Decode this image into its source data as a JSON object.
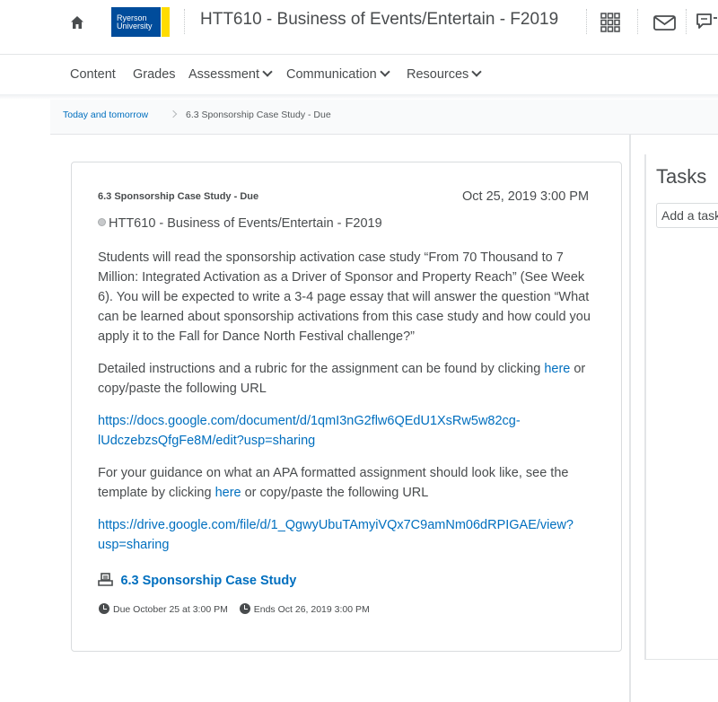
{
  "header": {
    "logo_text_line1": "Ryerson",
    "logo_text_line2": "University",
    "course_title": "HTT610 - Business of Events/Entertain - F2019",
    "icons": [
      "home-icon",
      "apps-grid-icon",
      "mail-icon",
      "chat-icon"
    ]
  },
  "nav": {
    "items": [
      {
        "label": "Content",
        "has_menu": false
      },
      {
        "label": "Grades",
        "has_menu": false
      },
      {
        "label": "Assessment",
        "has_menu": true
      },
      {
        "label": "Communication",
        "has_menu": true
      },
      {
        "label": "Resources",
        "has_menu": true
      }
    ]
  },
  "breadcrumb": {
    "link": "Today and tomorrow",
    "current": "6.3 Sponsorship Case Study - Due"
  },
  "event": {
    "title": "6.3 Sponsorship Case Study - Due",
    "date": "Oct 25, 2019 3:00 PM",
    "course": "HTT610 - Business of Events/Entertain - F2019",
    "paragraph1": "Students will read the sponsorship activation case study “From 70 Thousand to 7 Million: Integrated Activation as a Driver of Sponsor and Property Reach” (See Week 6).  You will be expected to write a 3-4 page essay that will answer the question “What can be learned about sponsorship activations from this case study and how could you apply it to the Fall for Dance North Festival challenge?”",
    "paragraph2_before": "Detailed instructions and a rubric for the assignment can be found by clicking ",
    "paragraph2_link": "here",
    "paragraph2_after": " or copy/paste the following URL",
    "url1_line1": "https://docs.google.com/document/d/1qmI3nG2flw6QEdU1XsRw5w82cg-",
    "url1_line2": "lUdczebzsQfgFe8M/edit?usp=sharing",
    "paragraph3_before": "For your guidance on what an APA formatted assignment should look like, see the template by clicking ",
    "paragraph3_link": "here",
    "paragraph3_after": " or copy/paste the following URL",
    "url2_line1": "https://drive.google.com/file/d/1_QgwyUbuTAmyiVQx7C9amNm06dRPIGAE/view?",
    "url2_line2": "usp=sharing",
    "attachment_label": "6.3 Sponsorship Case Study",
    "due_text": "Due October 25 at 3:00 PM",
    "ends_text": "Ends Oct 26, 2019 3:00 PM"
  },
  "tasks": {
    "title": "Tasks",
    "input_placeholder": "Add a task"
  },
  "colors": {
    "link": "#006fbf",
    "text": "#494c4e",
    "logo_blue": "#004c9b",
    "logo_gold": "#ffdc00"
  }
}
